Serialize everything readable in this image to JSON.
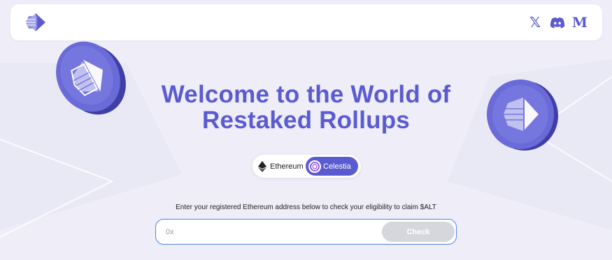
{
  "header": {
    "logo_icon": "altlayer-logo-icon",
    "social": [
      {
        "name": "x-icon",
        "glyph": "𝕏"
      },
      {
        "name": "discord-icon",
        "glyph": ""
      },
      {
        "name": "medium-icon",
        "glyph": "M"
      }
    ]
  },
  "hero": {
    "title": "Welcome to the World of Restaked Rollups"
  },
  "network_toggle": {
    "options": [
      {
        "label": "Ethereum",
        "icon": "ethereum-icon",
        "selected": false
      },
      {
        "label": "Celestia",
        "icon": "celestia-icon",
        "selected": true
      }
    ]
  },
  "claim": {
    "instruction": "Enter your registered Ethereum address below to check your eligibility to claim $ALT",
    "address_placeholder": "0x",
    "address_value": "",
    "check_label": "Check"
  },
  "colors": {
    "accent": "#5b5bd1",
    "background": "#eeedf8",
    "input_border": "#4f86e8",
    "button_disabled": "#d6d7dd"
  }
}
